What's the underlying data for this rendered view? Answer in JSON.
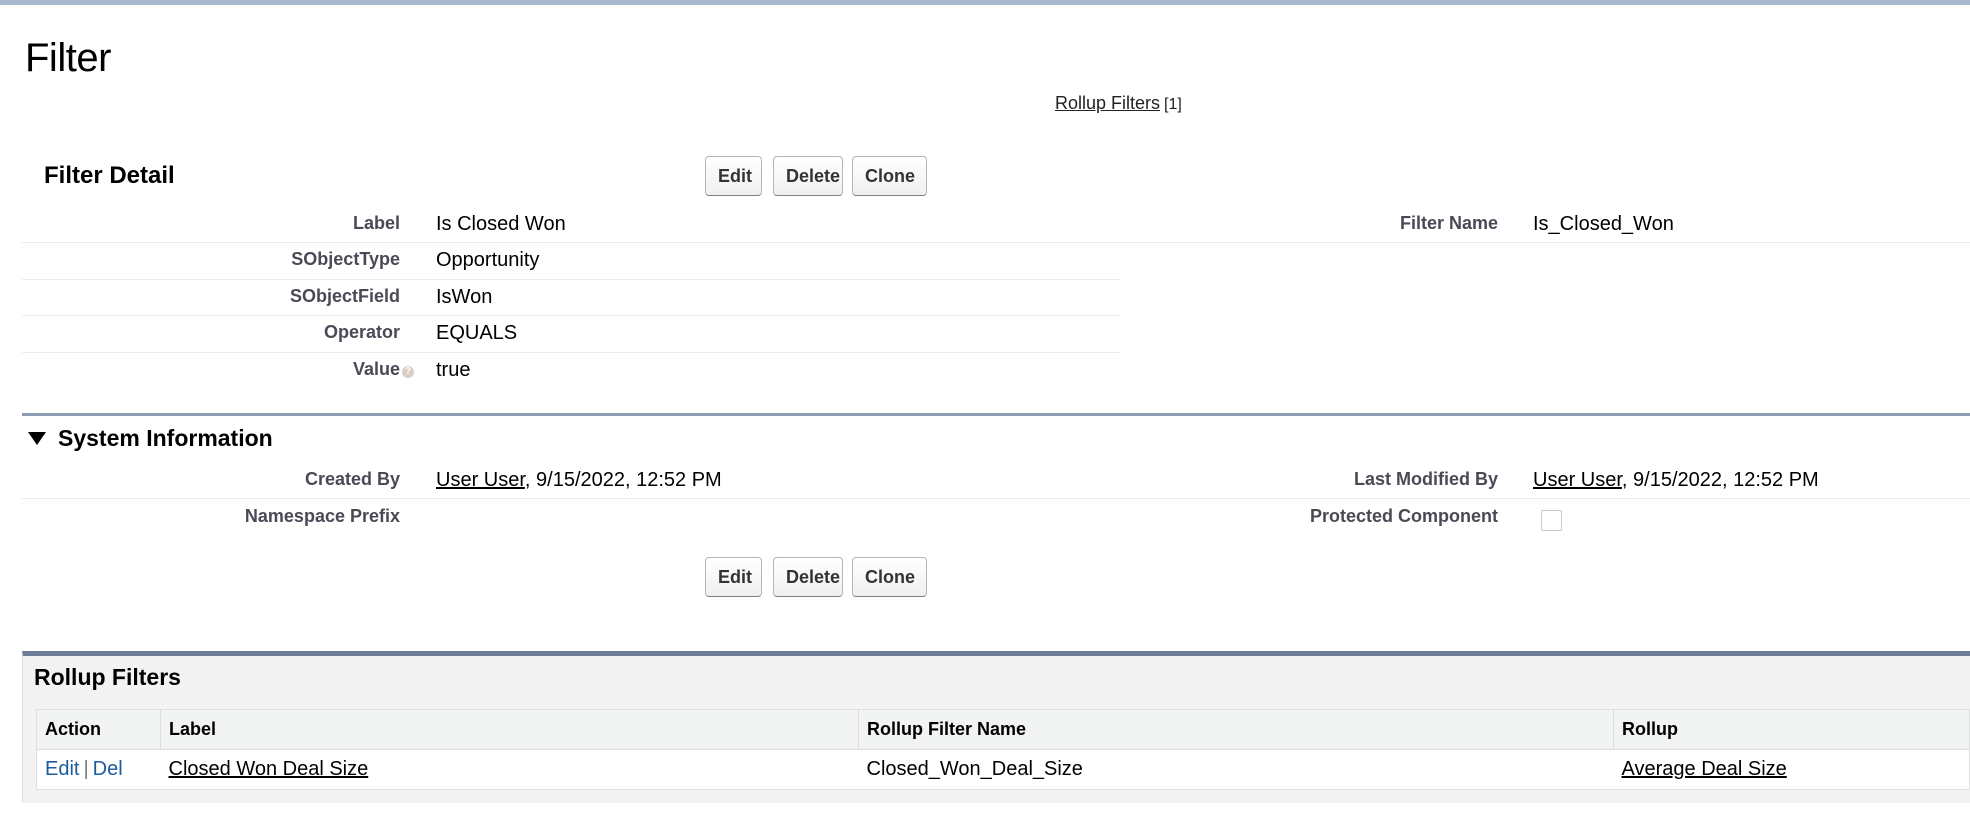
{
  "page": {
    "title": "Filter"
  },
  "related_link": {
    "label": "Rollup Filters",
    "count": "[1]"
  },
  "detail": {
    "heading": "Filter Detail",
    "buttons": {
      "edit": "Edit",
      "delete": "Delete",
      "clone": "Clone"
    },
    "fields": {
      "label": {
        "name": "Label",
        "value": "Is Closed Won"
      },
      "sobject_type": {
        "name": "SObjectType",
        "value": "Opportunity"
      },
      "sobject_field": {
        "name": "SObjectField",
        "value": "IsWon"
      },
      "operator": {
        "name": "Operator",
        "value": "EQUALS"
      },
      "value": {
        "name": "Value",
        "value": "true",
        "help_icon": "?"
      },
      "filter_name": {
        "name": "Filter Name",
        "value": "Is_Closed_Won"
      }
    }
  },
  "system_info": {
    "heading": "System Information",
    "created_by": {
      "name": "Created By",
      "user": "User User",
      "date": ", 9/15/2022, 12:52 PM"
    },
    "last_modified_by": {
      "name": "Last Modified By",
      "user": "User User",
      "date": ", 9/15/2022, 12:52 PM"
    },
    "namespace_prefix": {
      "name": "Namespace Prefix",
      "value": ""
    },
    "protected_component": {
      "name": "Protected Component",
      "checked": false
    }
  },
  "rollup_filters": {
    "heading": "Rollup Filters",
    "columns": [
      "Action",
      "Label",
      "Rollup Filter Name",
      "Rollup"
    ],
    "rows": [
      {
        "edit": "Edit",
        "separator": "|",
        "del": "Del",
        "label": "Closed Won Deal Size",
        "filter_name": "Closed_Won_Deal_Size",
        "rollup": "Average Deal Size"
      }
    ]
  }
}
